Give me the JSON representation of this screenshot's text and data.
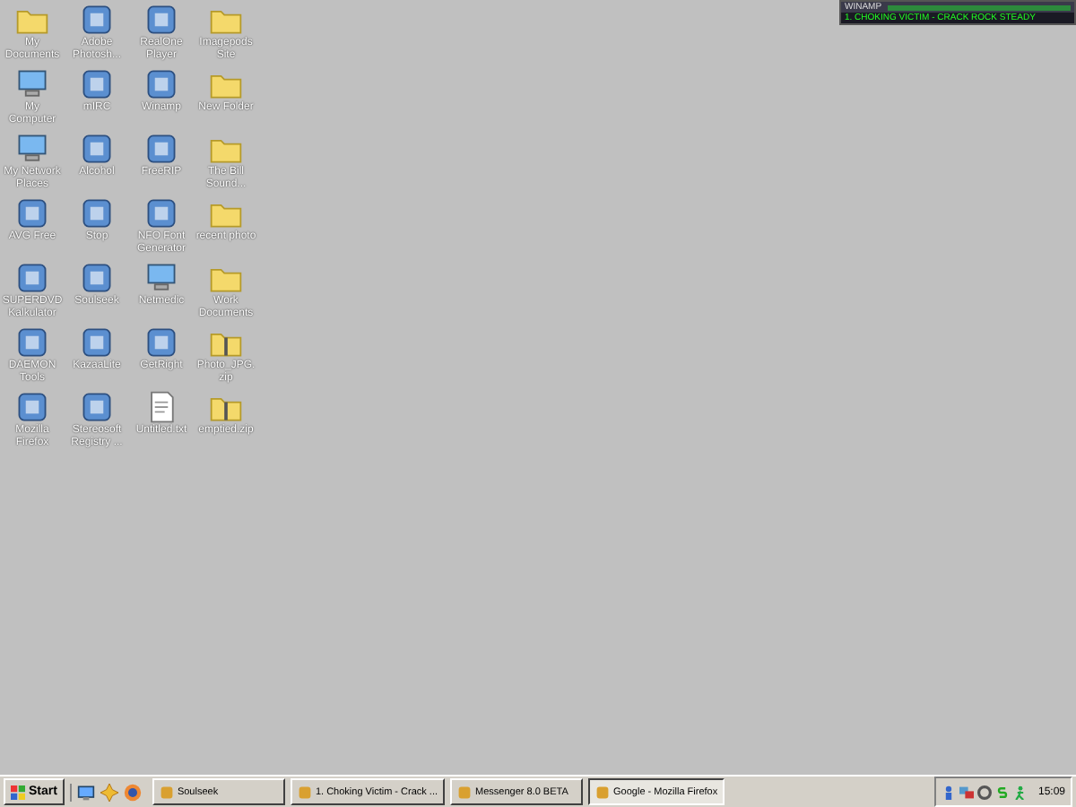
{
  "desktop_icons": [
    {
      "label": "My Documents",
      "kind": "folder"
    },
    {
      "label": "Adobe Photosh...",
      "kind": "app"
    },
    {
      "label": "RealOne Player",
      "kind": "app"
    },
    {
      "label": "Imagepods Site",
      "kind": "folder"
    },
    {
      "label": "My Computer",
      "kind": "computer"
    },
    {
      "label": "mIRC",
      "kind": "app"
    },
    {
      "label": "Winamp",
      "kind": "app"
    },
    {
      "label": "New Folder",
      "kind": "folder"
    },
    {
      "label": "My Network Places",
      "kind": "computer"
    },
    {
      "label": "Alcohol",
      "kind": "app"
    },
    {
      "label": "FreeRIP",
      "kind": "app"
    },
    {
      "label": "The Bill Sound...",
      "kind": "folder"
    },
    {
      "label": "AVG Free",
      "kind": "app"
    },
    {
      "label": "Stop",
      "kind": "app"
    },
    {
      "label": "NFO Font Generator",
      "kind": "app"
    },
    {
      "label": "recent photo",
      "kind": "folder"
    },
    {
      "label": "SUPERDVD Kalkulator",
      "kind": "app"
    },
    {
      "label": "Soulseek",
      "kind": "app"
    },
    {
      "label": "Netmedic",
      "kind": "computer"
    },
    {
      "label": "Work Documents",
      "kind": "folder"
    },
    {
      "label": "DAEMON Tools",
      "kind": "app"
    },
    {
      "label": "KazaaLite",
      "kind": "app"
    },
    {
      "label": "GetRight",
      "kind": "app"
    },
    {
      "label": "Photo_JPG.zip",
      "kind": "zip"
    },
    {
      "label": "Mozilla Firefox",
      "kind": "app"
    },
    {
      "label": "Stereosoft Registry ...",
      "kind": "app"
    },
    {
      "label": "Untitled.txt",
      "kind": "document"
    },
    {
      "label": "emptied.zip",
      "kind": "zip"
    }
  ],
  "winamp": {
    "title": "WINAMP",
    "track": "1. CHOKING VICTIM - CRACK ROCK STEADY"
  },
  "taskbar": {
    "start_label": "Start",
    "tasks": [
      {
        "label": "Soulseek",
        "selected": false
      },
      {
        "label": "1. Choking Victim - Crack ...",
        "selected": false
      },
      {
        "label": "Messenger 8.0 BETA",
        "selected": false
      },
      {
        "label": "Google - Mozilla Firefox",
        "selected": true
      }
    ],
    "clock": "15:09"
  }
}
